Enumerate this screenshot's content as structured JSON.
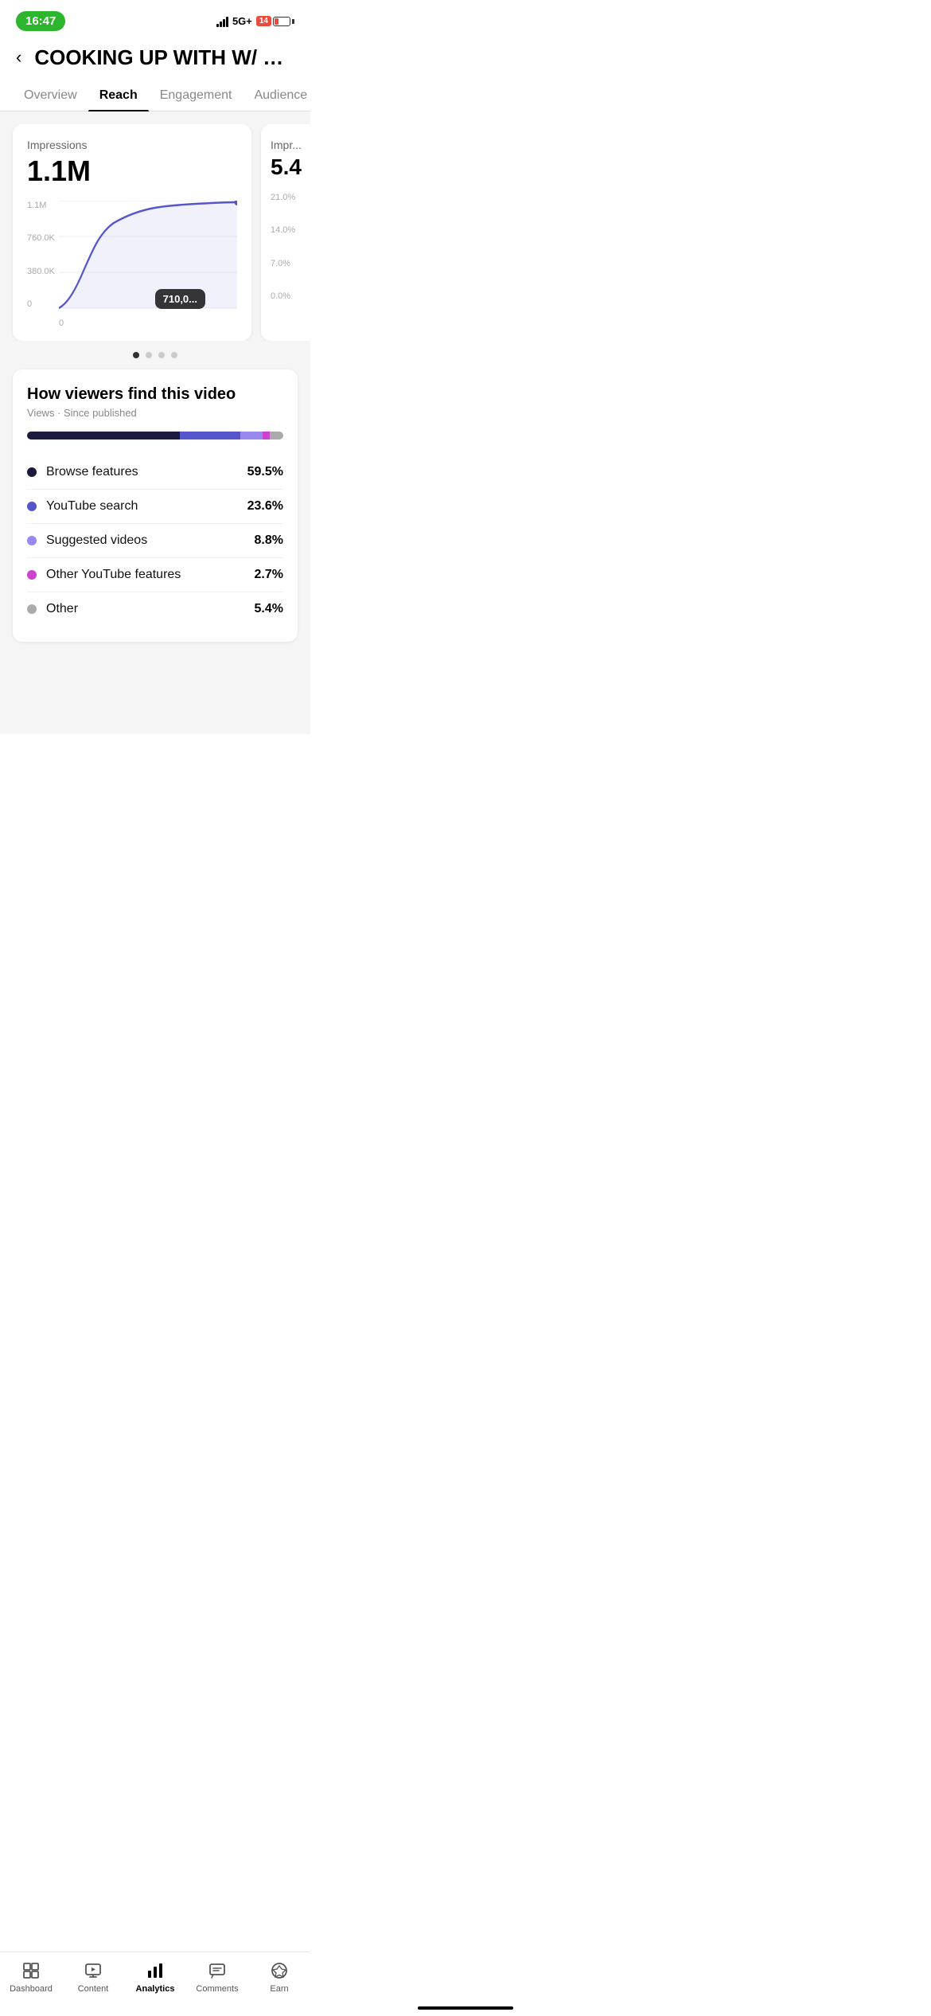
{
  "statusBar": {
    "time": "16:47",
    "network": "5G+",
    "batteryNumber": "14"
  },
  "header": {
    "backLabel": "‹",
    "title": "COOKING UP WITH W/ GU..."
  },
  "tabs": [
    {
      "id": "overview",
      "label": "Overview"
    },
    {
      "id": "reach",
      "label": "Reach",
      "active": true
    },
    {
      "id": "engagement",
      "label": "Engagement"
    },
    {
      "id": "audience",
      "label": "Audience"
    }
  ],
  "metricsCards": [
    {
      "id": "impressions",
      "label": "Impressions",
      "value": "1.1M",
      "yLabels": [
        "1.1M",
        "760.0K",
        "380.0K",
        "0"
      ],
      "xLabels": [
        "0",
        "710,0..."
      ],
      "tooltipValue": "710,0..."
    },
    {
      "id": "impressions2",
      "label": "Impressions",
      "value": "5.4",
      "yLabels": [
        "21.0%",
        "14.0%",
        "7.0%",
        "0.0%"
      ]
    }
  ],
  "paginationDots": [
    {
      "active": true
    },
    {
      "active": false
    },
    {
      "active": false
    },
    {
      "active": false
    }
  ],
  "viewerSection": {
    "title": "How viewers find this video",
    "subtitle": "Views · Since published",
    "sources": [
      {
        "id": "browse",
        "label": "Browse features",
        "pct": "59.5%",
        "color": "#1a1a3e"
      },
      {
        "id": "search",
        "label": "YouTube search",
        "pct": "23.6%",
        "color": "#5555cc"
      },
      {
        "id": "suggested",
        "label": "Suggested videos",
        "pct": "8.8%",
        "color": "#9988ee"
      },
      {
        "id": "other-yt",
        "label": "Other YouTube features",
        "pct": "2.7%",
        "color": "#cc44cc"
      },
      {
        "id": "other",
        "label": "Other",
        "pct": "5.4%",
        "color": "#aaaaaa"
      }
    ],
    "barSegments": [
      {
        "color": "#1a1a3e",
        "flex": 59.5
      },
      {
        "color": "#5555cc",
        "flex": 23.6
      },
      {
        "color": "#9988ee",
        "flex": 8.8
      },
      {
        "color": "#cc44cc",
        "flex": 2.7
      },
      {
        "color": "#aaaaaa",
        "flex": 5.4
      }
    ]
  },
  "bottomNav": [
    {
      "id": "dashboard",
      "label": "Dashboard",
      "icon": "dashboard"
    },
    {
      "id": "content",
      "label": "Content",
      "icon": "content"
    },
    {
      "id": "analytics",
      "label": "Analytics",
      "icon": "analytics",
      "active": false
    },
    {
      "id": "comments",
      "label": "Comments",
      "icon": "comments"
    },
    {
      "id": "earn",
      "label": "Earn",
      "icon": "earn"
    }
  ]
}
